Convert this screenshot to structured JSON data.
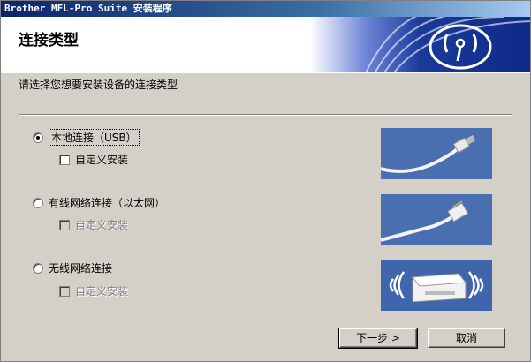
{
  "window": {
    "title": "Brother MFL-Pro Suite 安装程序"
  },
  "header": {
    "title": "连接类型"
  },
  "instruction": "请选择您想要安装设备的连接类型",
  "options": [
    {
      "label": "本地连接（USB）",
      "selected": true,
      "custom_install": {
        "label": "自定义安装",
        "checked": false,
        "enabled": true
      },
      "image": "usb-cable"
    },
    {
      "label": "有线网络连接（以太网）",
      "selected": false,
      "custom_install": {
        "label": "自定义安装",
        "checked": false,
        "enabled": false
      },
      "image": "ethernet-cable"
    },
    {
      "label": "无线网络连接",
      "selected": false,
      "custom_install": {
        "label": "自定义安装",
        "checked": false,
        "enabled": false
      },
      "image": "wireless-printer"
    }
  ],
  "buttons": {
    "next": "下一步 >",
    "cancel": "取消"
  },
  "colors": {
    "titlebar": "#0a246a",
    "banner": "#1a3a9a",
    "picture_bg": "#4a6fb0",
    "dialog_bg": "#d4d0c8"
  }
}
